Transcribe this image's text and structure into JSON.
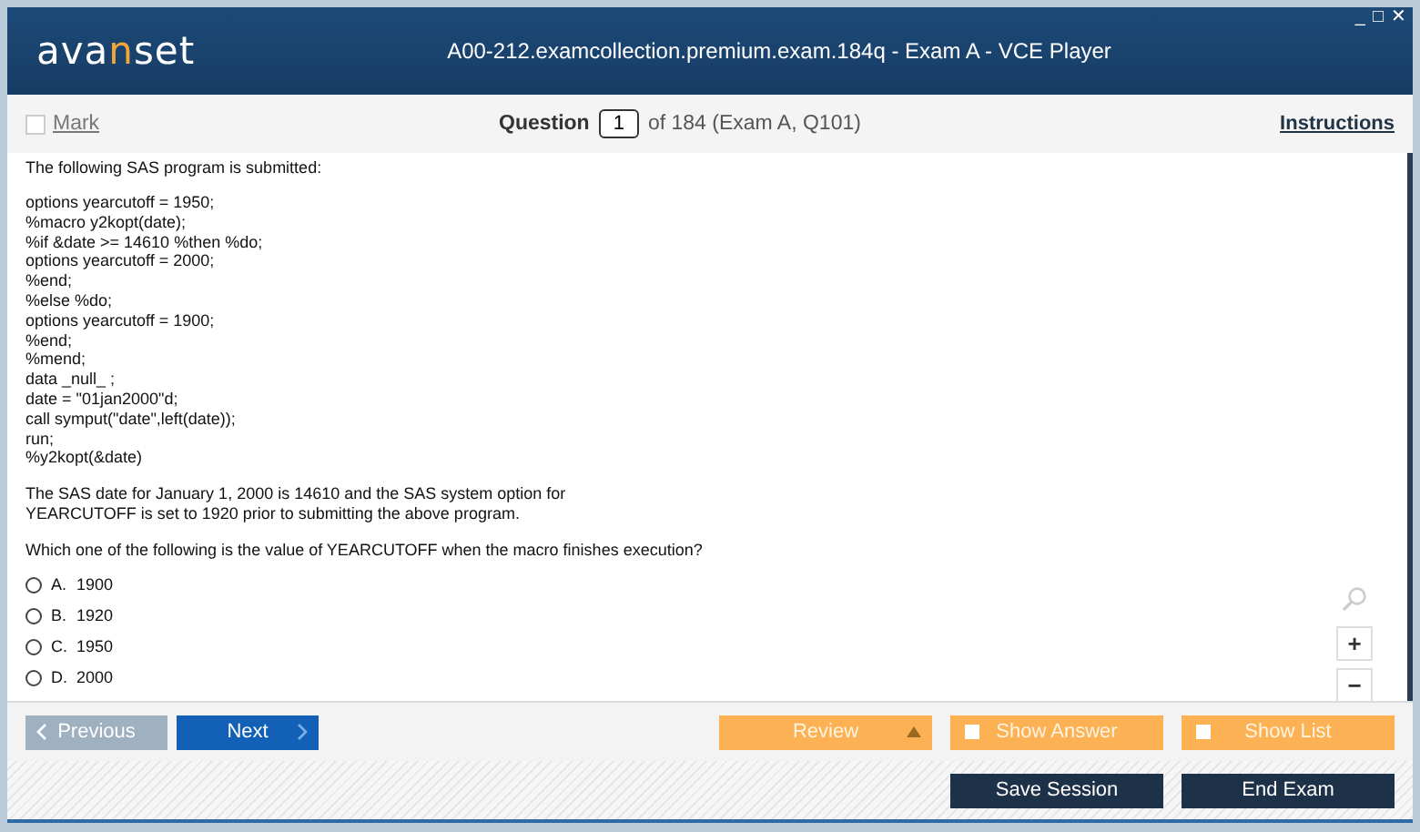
{
  "window": {
    "title": "A00-212.examcollection.premium.exam.184q - Exam A - VCE Player",
    "controls": [
      "_",
      "□",
      "✕"
    ]
  },
  "logo": {
    "before": "ava",
    "highlight": "n",
    "after": "set"
  },
  "toolbar": {
    "mark": {
      "label": "Mark",
      "checked": false
    },
    "question_label": "Question",
    "question_number": "1",
    "question_of": "of 184 (Exam A, Q101)",
    "instructions": "Instructions"
  },
  "question": {
    "intro": "The following SAS program is submitted:",
    "code": [
      "options yearcutoff = 1950;",
      "%macro y2kopt(date);",
      "%if &date >= 14610 %then %do;",
      "options yearcutoff = 2000;",
      "%end;",
      "%else %do;",
      "options yearcutoff = 1900;",
      "%end;",
      "%mend;",
      "data _null_ ;",
      "date = \"01jan2000\"d;",
      "call symput(\"date\",left(date));",
      "run;",
      "%y2kopt(&date)"
    ],
    "note": [
      "The SAS date for January 1, 2000 is 14610 and the SAS system option for",
      "YEARCUTOFF is set to 1920 prior to submitting the above program."
    ],
    "prompt": "Which one of the following is the value of YEARCUTOFF when the macro finishes execution?",
    "options": [
      {
        "letter": "A.",
        "text": "1900",
        "selected": false
      },
      {
        "letter": "B.",
        "text": "1920",
        "selected": false
      },
      {
        "letter": "C.",
        "text": "1950",
        "selected": false
      },
      {
        "letter": "D.",
        "text": "2000",
        "selected": false
      }
    ]
  },
  "zoom": {
    "plus": "+",
    "minus": "−"
  },
  "nav": {
    "previous": {
      "label": "Previous",
      "disabled": true
    },
    "next": {
      "label": "Next",
      "disabled": false
    },
    "review": "Review",
    "show_answer": {
      "label": "Show Answer",
      "checked": false
    },
    "show_list": {
      "label": "Show List",
      "checked": false
    }
  },
  "footer": {
    "buttons": [
      "Save Session",
      "End Exam"
    ]
  }
}
